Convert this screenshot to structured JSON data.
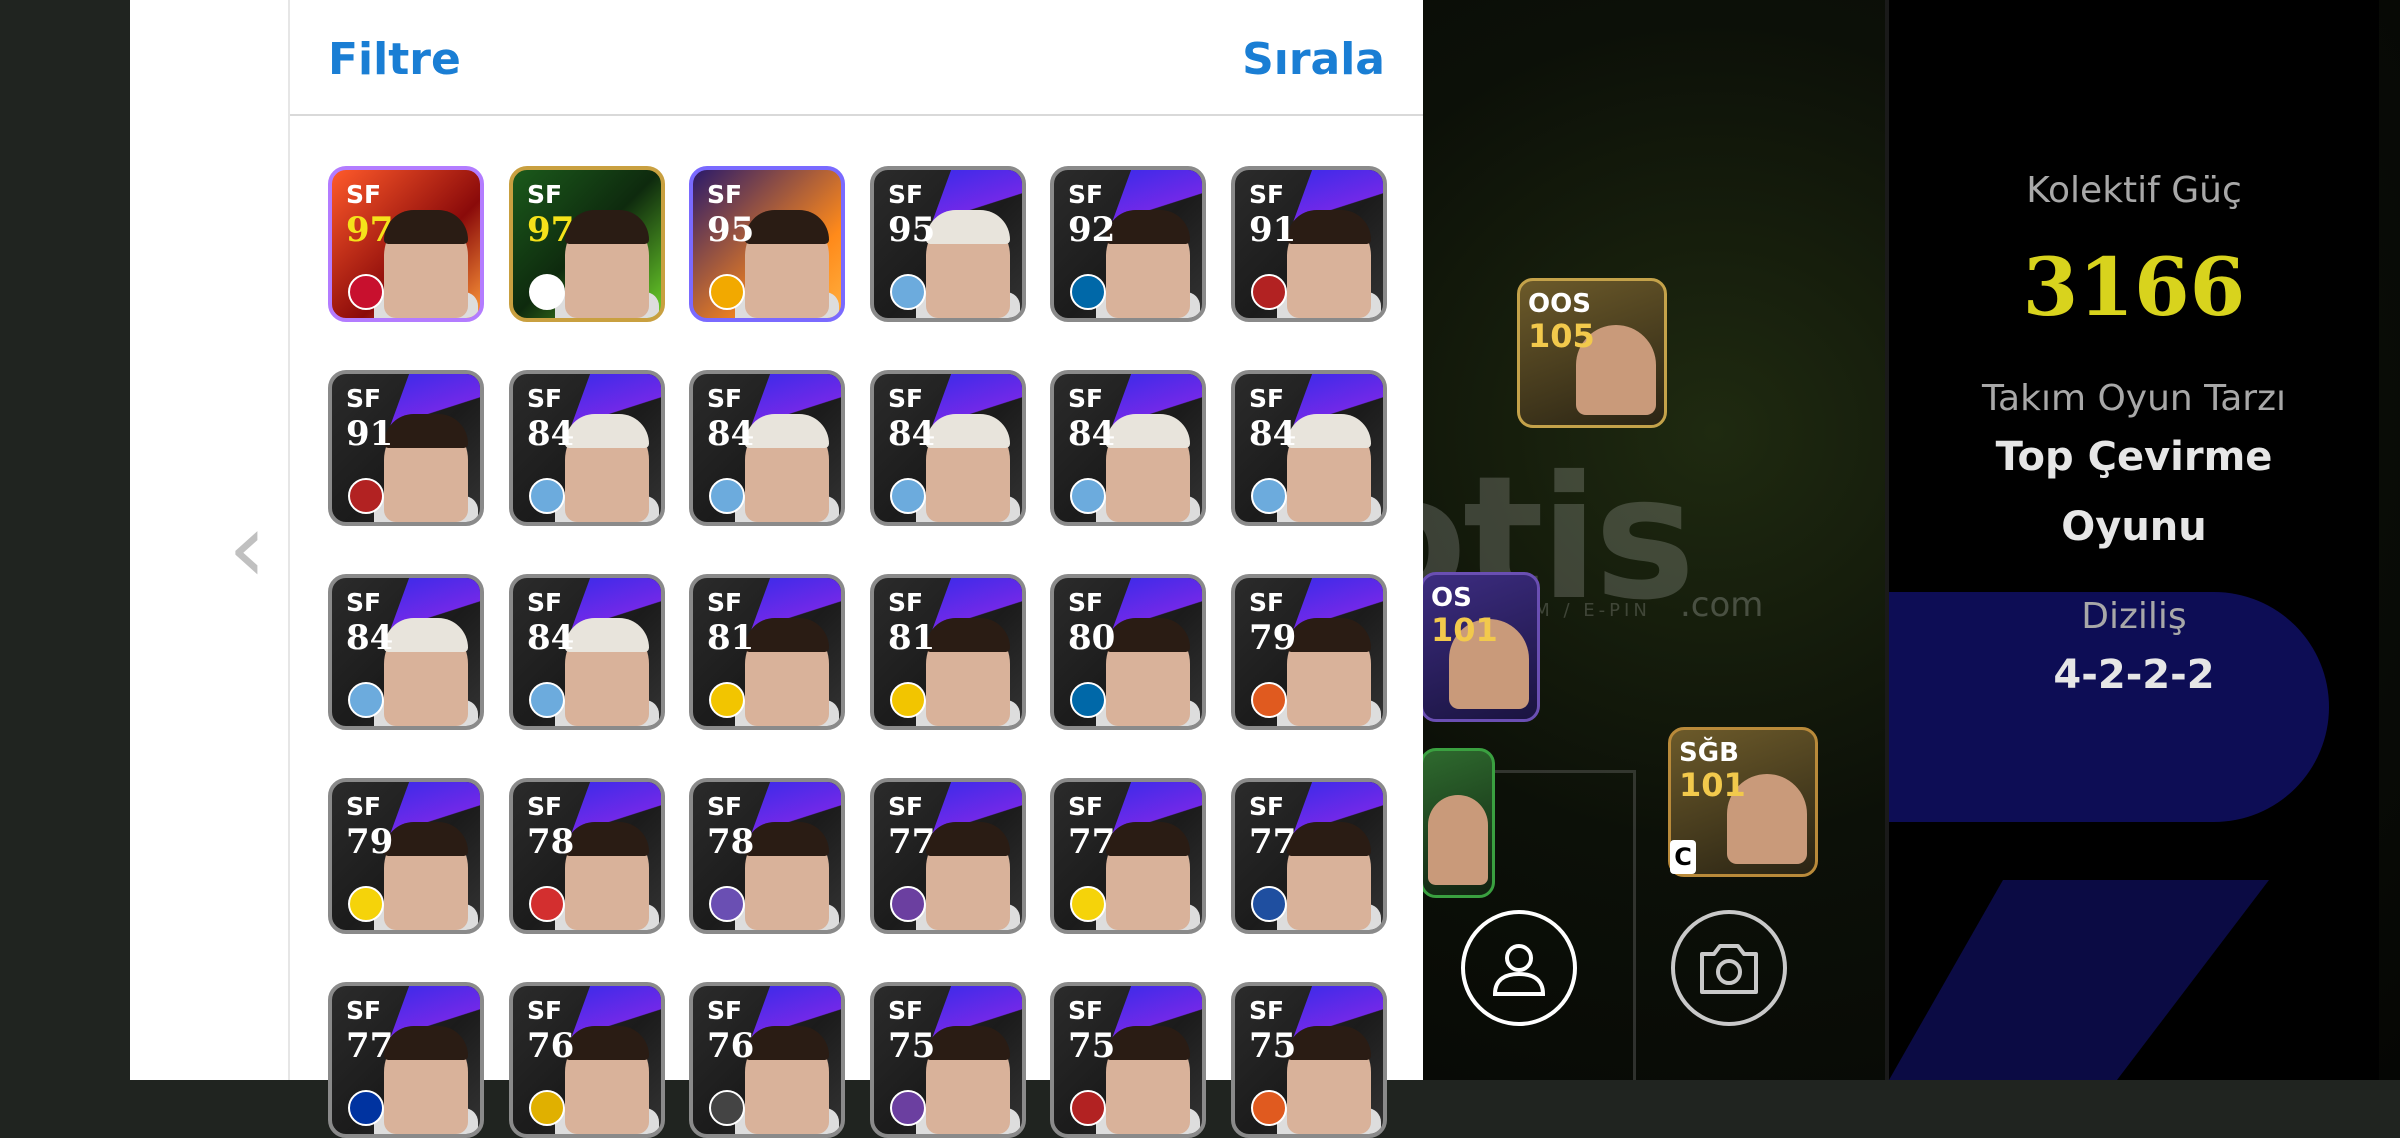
{
  "header": {
    "filter_label": "Filtre",
    "sort_label": "Sırala"
  },
  "nav": {
    "back_arrow": "‹"
  },
  "info_panel": {
    "power_label": "Kolektif Güç",
    "power_value": "3166",
    "style_label": "Takım Oyun Tarzı",
    "style_value_line1": "Top Çevirme",
    "style_value_line2": "Oyunu",
    "formation_label": "Diziliş",
    "formation_value": "4-2-2-2"
  },
  "field_cards": [
    {
      "pos": "OOS",
      "rating": "105"
    },
    {
      "pos": "OS",
      "rating": "101"
    },
    {
      "pos": "SĞB",
      "rating": "101"
    }
  ],
  "captain_badge": "C",
  "watermark": {
    "main": "otis",
    "sub": "HES · KIN / ITEM / E-PIN",
    "com": ".com"
  },
  "buttons": {
    "profile_icon": "person-icon",
    "camera_icon": "camera-icon"
  },
  "players": [
    {
      "pos": "SF",
      "rating": "97",
      "style": "special-red",
      "club": "#c8102e"
    },
    {
      "pos": "SF",
      "rating": "97",
      "style": "special-green",
      "club": "#ffffff"
    },
    {
      "pos": "SF",
      "rating": "95",
      "style": "special-orange",
      "club": "#f2a900"
    },
    {
      "pos": "SF",
      "rating": "95",
      "style": "normal",
      "club": "#6cabdd"
    },
    {
      "pos": "SF",
      "rating": "92",
      "style": "normal",
      "club": "#0068a8"
    },
    {
      "pos": "SF",
      "rating": "91",
      "style": "normal",
      "club": "#b22222"
    },
    {
      "pos": "SF",
      "rating": "91",
      "style": "normal",
      "club": "#b22222"
    },
    {
      "pos": "SF",
      "rating": "84",
      "style": "normal",
      "club": "#6cabdd"
    },
    {
      "pos": "SF",
      "rating": "84",
      "style": "normal",
      "club": "#6cabdd"
    },
    {
      "pos": "SF",
      "rating": "84",
      "style": "normal",
      "club": "#6cabdd"
    },
    {
      "pos": "SF",
      "rating": "84",
      "style": "normal",
      "club": "#6cabdd"
    },
    {
      "pos": "SF",
      "rating": "84",
      "style": "normal",
      "club": "#6cabdd"
    },
    {
      "pos": "SF",
      "rating": "84",
      "style": "normal",
      "club": "#6cabdd"
    },
    {
      "pos": "SF",
      "rating": "84",
      "style": "normal",
      "club": "#6cabdd"
    },
    {
      "pos": "SF",
      "rating": "81",
      "style": "normal",
      "club": "#f2c500"
    },
    {
      "pos": "SF",
      "rating": "81",
      "style": "normal",
      "club": "#f2c500"
    },
    {
      "pos": "SF",
      "rating": "80",
      "style": "normal",
      "club": "#0068a8"
    },
    {
      "pos": "SF",
      "rating": "79",
      "style": "normal",
      "club": "#e05a1f"
    },
    {
      "pos": "SF",
      "rating": "79",
      "style": "normal",
      "club": "#f5d30a"
    },
    {
      "pos": "SF",
      "rating": "78",
      "style": "normal",
      "club": "#d32f2f"
    },
    {
      "pos": "SF",
      "rating": "78",
      "style": "normal",
      "club": "#6a4fb3"
    },
    {
      "pos": "SF",
      "rating": "77",
      "style": "normal",
      "club": "#6b3fa0"
    },
    {
      "pos": "SF",
      "rating": "77",
      "style": "normal",
      "club": "#f5d30a"
    },
    {
      "pos": "SF",
      "rating": "77",
      "style": "normal",
      "club": "#1f4fa0"
    },
    {
      "pos": "SF",
      "rating": "77",
      "style": "normal",
      "club": "#0033a0"
    },
    {
      "pos": "SF",
      "rating": "76",
      "style": "normal",
      "club": "#e0b000"
    },
    {
      "pos": "SF",
      "rating": "76",
      "style": "normal",
      "club": "#444444"
    },
    {
      "pos": "SF",
      "rating": "75",
      "style": "normal",
      "club": "#6b3fa0"
    },
    {
      "pos": "SF",
      "rating": "75",
      "style": "normal",
      "club": "#b22222"
    },
    {
      "pos": "SF",
      "rating": "75",
      "style": "normal",
      "club": "#e05a1f"
    }
  ],
  "colors": {
    "accent": "#1a7ed4",
    "power": "#d8d31d",
    "formation_pill": "#0d0d55"
  }
}
